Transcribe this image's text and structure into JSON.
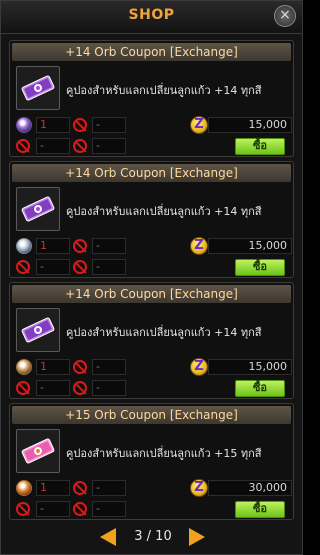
{
  "window": {
    "title": "SHOP",
    "close_glyph": "×"
  },
  "items": [
    {
      "header": "+14 Orb Coupon [Exchange]",
      "description": "คูปองสำหรับแลกเปลี่ยนลูกแก้ว +14 ทุกสี",
      "gem_color": "purple",
      "count_1": "1",
      "field_2": "-",
      "field_3": "-",
      "field_4": "-",
      "currency_icon": "Z",
      "price": "15,000",
      "buy_label": "ซื้อ"
    },
    {
      "header": "+14 Orb Coupon [Exchange]",
      "description": "คูปองสำหรับแลกเปลี่ยนลูกแก้ว +14 ทุกสี",
      "gem_color": "silver",
      "count_1": "1",
      "field_2": "-",
      "field_3": "-",
      "field_4": "-",
      "currency_icon": "Z",
      "price": "15,000",
      "buy_label": "ซื้อ"
    },
    {
      "header": "+14 Orb Coupon [Exchange]",
      "description": "คูปองสำหรับแลกเปลี่ยนลูกแก้ว +14 ทุกสี",
      "gem_color": "bronze",
      "count_1": "1",
      "field_2": "-",
      "field_3": "-",
      "field_4": "-",
      "currency_icon": "Z",
      "price": "15,000",
      "buy_label": "ซื้อ"
    },
    {
      "header": "+15 Orb Coupon [Exchange]",
      "description": "คูปองสำหรับแลกเปลี่ยนลูกแก้ว +15 ทุกสี",
      "gem_color": "orange",
      "count_1": "1",
      "field_2": "-",
      "field_3": "-",
      "field_4": "-",
      "currency_icon": "Z",
      "price": "30,000",
      "buy_label": "ซื้อ"
    }
  ],
  "pager": {
    "text": "3 / 10"
  },
  "colors": {
    "accent": "#f0a21f",
    "buy": "#8ad82c",
    "disabled": "#d41c1c"
  }
}
